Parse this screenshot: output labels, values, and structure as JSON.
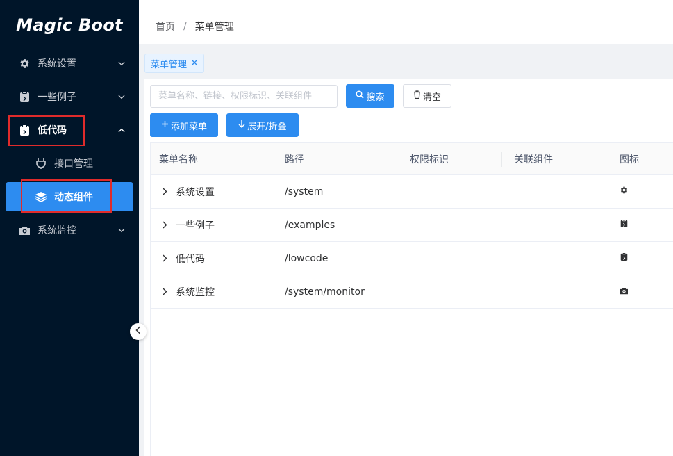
{
  "app": {
    "logo": "Magic Boot"
  },
  "sidebar": {
    "items": [
      {
        "label": "系统设置",
        "icon": "gear-icon"
      },
      {
        "label": "一些例子",
        "icon": "clipboard-icon"
      },
      {
        "label": "低代码",
        "icon": "clipboard-icon",
        "open": true,
        "children": [
          {
            "label": "接口管理",
            "icon": "plug-icon"
          },
          {
            "label": "动态组件",
            "icon": "layers-icon",
            "active": true
          }
        ]
      },
      {
        "label": "系统监控",
        "icon": "camera-icon"
      }
    ]
  },
  "breadcrumb": {
    "home": "首页",
    "separator": "/",
    "current": "菜单管理"
  },
  "tags": [
    {
      "label": "菜单管理",
      "closable": true
    }
  ],
  "toolbar": {
    "search_placeholder": "菜单名称、链接、权限标识、关联组件",
    "search_value": "",
    "search_label": "搜索",
    "clear_label": "清空",
    "add_label": "添加菜单",
    "toggle_label": "展开/折叠"
  },
  "table": {
    "columns": [
      "菜单名称",
      "路径",
      "权限标识",
      "关联组件",
      "图标"
    ],
    "rows": [
      {
        "name": "系统设置",
        "path": "/system",
        "permission": "",
        "component": "",
        "icon": "gear-icon"
      },
      {
        "name": "一些例子",
        "path": "/examples",
        "permission": "",
        "component": "",
        "icon": "clipboard-icon"
      },
      {
        "name": "低代码",
        "path": "/lowcode",
        "permission": "",
        "component": "",
        "icon": "clipboard-icon"
      },
      {
        "name": "系统监控",
        "path": "/system/monitor",
        "permission": "",
        "component": "",
        "icon": "camera-icon"
      }
    ]
  },
  "colors": {
    "sidebar_bg": "#001529",
    "primary": "#2d8cf0",
    "highlight_box": "#e02b2b"
  }
}
